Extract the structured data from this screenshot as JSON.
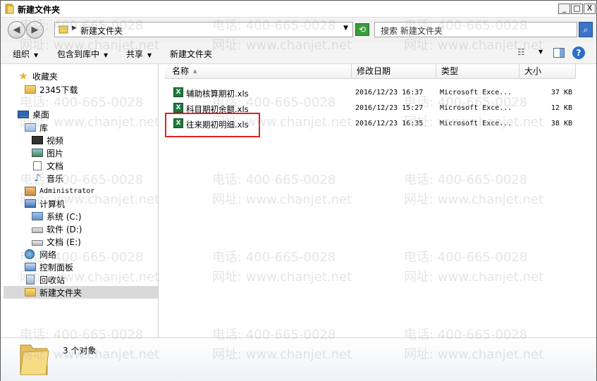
{
  "window": {
    "title": "新建文件夹",
    "controls": {
      "minimize": "_",
      "maximize": "□",
      "close": "X"
    }
  },
  "address": {
    "path": "新建文件夹",
    "search_placeholder": "搜索 新建文件夹"
  },
  "toolbar": {
    "items": [
      "组织",
      "包含到库中",
      "共享",
      "新建文件夹"
    ]
  },
  "nav": {
    "favorites": "收藏夹",
    "downloads": "2345下载",
    "desktop": "桌面",
    "library": "库",
    "videos": "视频",
    "pictures": "图片",
    "documents": "文档",
    "music": "音乐",
    "user": "Administrator",
    "computer": "计算机",
    "drive_c": "系统 (C:)",
    "drive_d": "软件 (D:)",
    "drive_e": "文档 (E:)",
    "network": "网络",
    "control_panel": "控制面板",
    "recycle_bin": "回收站",
    "current_folder": "新建文件夹"
  },
  "columns": [
    "名称",
    "修改日期",
    "类型",
    "大小"
  ],
  "files": [
    {
      "name": "辅助核算期初.xls",
      "date": "2016/12/23 16:37",
      "type": "Microsoft Exce...",
      "size": "37 KB"
    },
    {
      "name": "科目期初余额.xls",
      "date": "2016/12/23 15:27",
      "type": "Microsoft Exce...",
      "size": "12 KB"
    },
    {
      "name": "往来期初明细.xls",
      "date": "2016/12/23 16:35",
      "type": "Microsoft Exce...",
      "size": "38 KB"
    }
  ],
  "status": {
    "count": "3 个对象"
  },
  "watermark": {
    "phone": "电话: 400-665-0028",
    "site": "网址: www.chanjet.net"
  }
}
